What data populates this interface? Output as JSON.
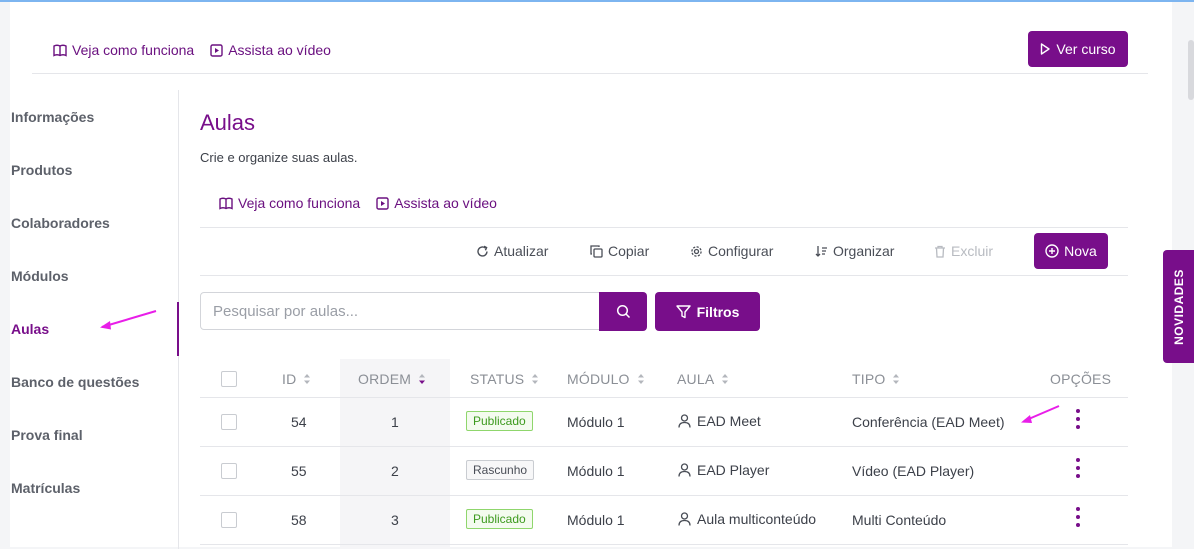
{
  "header": {
    "how_it_works": "Veja como funciona",
    "watch_video": "Assista ao vídeo",
    "ver_curso": "Ver curso"
  },
  "sidebar": {
    "items": [
      {
        "label": "Informações",
        "active": false
      },
      {
        "label": "Produtos",
        "active": false
      },
      {
        "label": "Colaboradores",
        "active": false
      },
      {
        "label": "Módulos",
        "active": false
      },
      {
        "label": "Aulas",
        "active": true
      },
      {
        "label": "Banco de questões",
        "active": false
      },
      {
        "label": "Prova final",
        "active": false
      },
      {
        "label": "Matrículas",
        "active": false
      }
    ]
  },
  "main": {
    "title": "Aulas",
    "subtitle": "Crie e organize suas aulas.",
    "how_it_works": "Veja como funciona",
    "watch_video": "Assista ao vídeo"
  },
  "toolbar": {
    "atualizar": "Atualizar",
    "copiar": "Copiar",
    "configurar": "Configurar",
    "organizar": "Organizar",
    "excluir": "Excluir",
    "nova": "Nova"
  },
  "search": {
    "placeholder": "Pesquisar por aulas...",
    "value": "",
    "filters_label": "Filtros"
  },
  "table": {
    "columns": [
      "ID",
      "ORDEM",
      "STATUS",
      "MÓDULO",
      "AULA",
      "TIPO",
      "OPÇÕES"
    ],
    "sorted_column": "ORDEM",
    "rows": [
      {
        "id": "54",
        "ordem": "1",
        "status": "Publicado",
        "status_type": "published",
        "modulo": "Módulo 1",
        "aula": "EAD Meet",
        "tipo": "Conferência (EAD Meet)"
      },
      {
        "id": "55",
        "ordem": "2",
        "status": "Rascunho",
        "status_type": "draft",
        "modulo": "Módulo 1",
        "aula": "EAD Player",
        "tipo": "Vídeo (EAD Player)"
      },
      {
        "id": "58",
        "ordem": "3",
        "status": "Publicado",
        "status_type": "published",
        "modulo": "Módulo 1",
        "aula": "Aula multiconteúdo",
        "tipo": "Multi Conteúdo"
      }
    ]
  },
  "side_tab": {
    "label": "NOVIDADES"
  },
  "colors": {
    "brand": "#780e8a",
    "annotation_arrow": "#e81ee8",
    "published": "#3d9a1e",
    "divider": "#e5e6ea"
  },
  "icons": [
    "book-icon",
    "video-icon",
    "play-icon",
    "refresh-icon",
    "copy-icon",
    "gear-icon",
    "sort-icon",
    "trash-icon",
    "plus-circle-icon",
    "search-icon",
    "filter-icon",
    "user-icon",
    "kebab-icon",
    "sort-arrows-icon"
  ]
}
